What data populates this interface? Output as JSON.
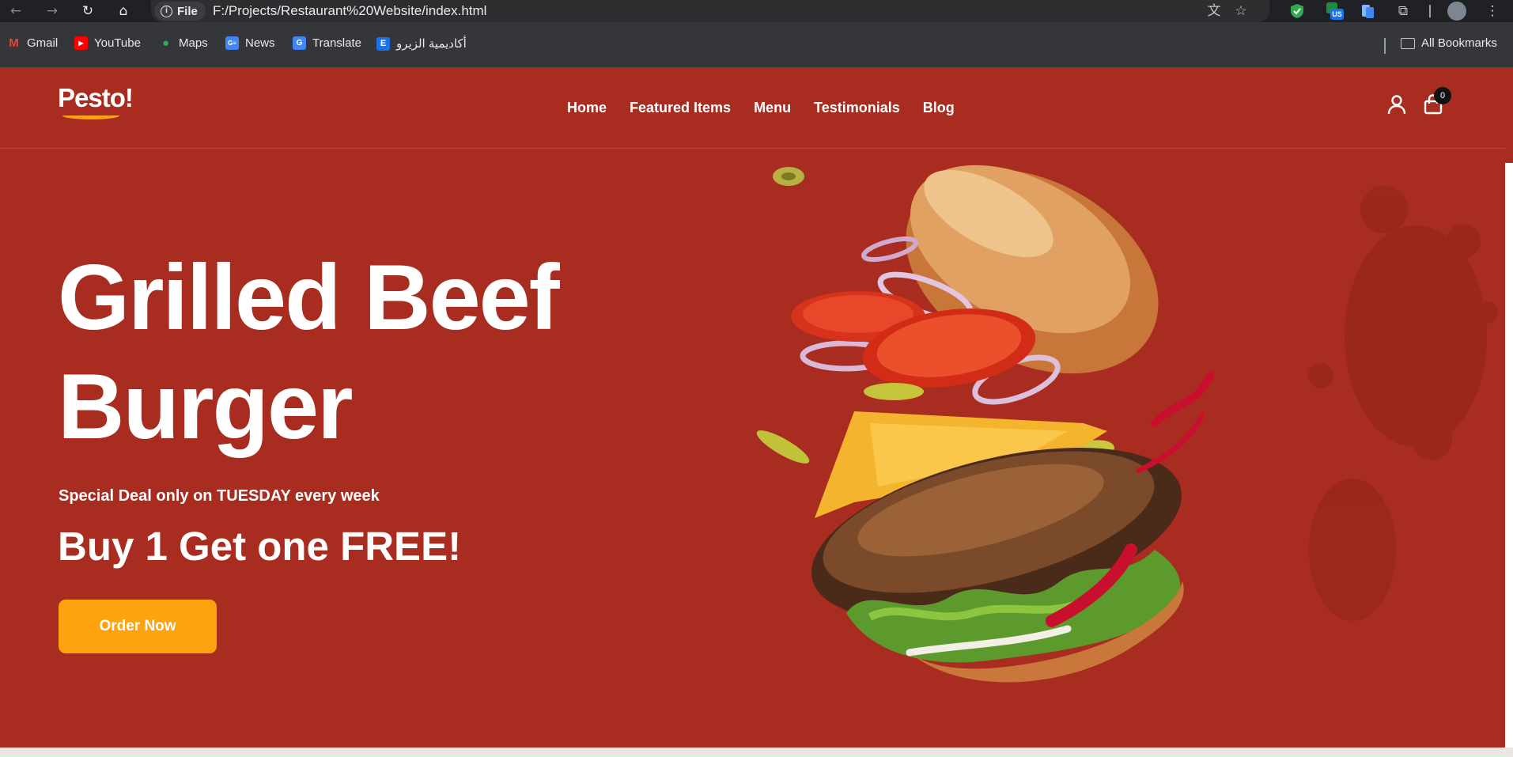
{
  "browser": {
    "file_chip": "File",
    "url": "F:/Projects/Restaurant%20Website/index.html",
    "bookmarks": [
      {
        "label": "Gmail",
        "icon": "gmail-icon",
        "color": "#ea4335"
      },
      {
        "label": "YouTube",
        "icon": "youtube-icon",
        "color": "#ff0000"
      },
      {
        "label": "Maps",
        "icon": "maps-icon",
        "color": "#34a853"
      },
      {
        "label": "News",
        "icon": "news-icon",
        "color": "#4285f4"
      },
      {
        "label": "Translate",
        "icon": "translate-icon",
        "color": "#4285f4"
      },
      {
        "label": "أكاديمية الزيرو",
        "icon": "e-academy-icon",
        "color": "#1a73e8"
      }
    ],
    "all_bookmarks": "All Bookmarks",
    "ext_badge": "US"
  },
  "site": {
    "logo": "Pesto!",
    "nav": [
      "Home",
      "Featured Items",
      "Menu",
      "Testimonials",
      "Blog"
    ],
    "cart_count": "0"
  },
  "hero": {
    "title": "Grilled Beef Burger",
    "deal": "Special Deal only on TUESDAY every week",
    "offer": "Buy 1 Get one FREE!",
    "cta": "Order Now"
  },
  "colors": {
    "background": "#a82c1f",
    "accent": "#ffa20f",
    "text": "#ffffff"
  }
}
